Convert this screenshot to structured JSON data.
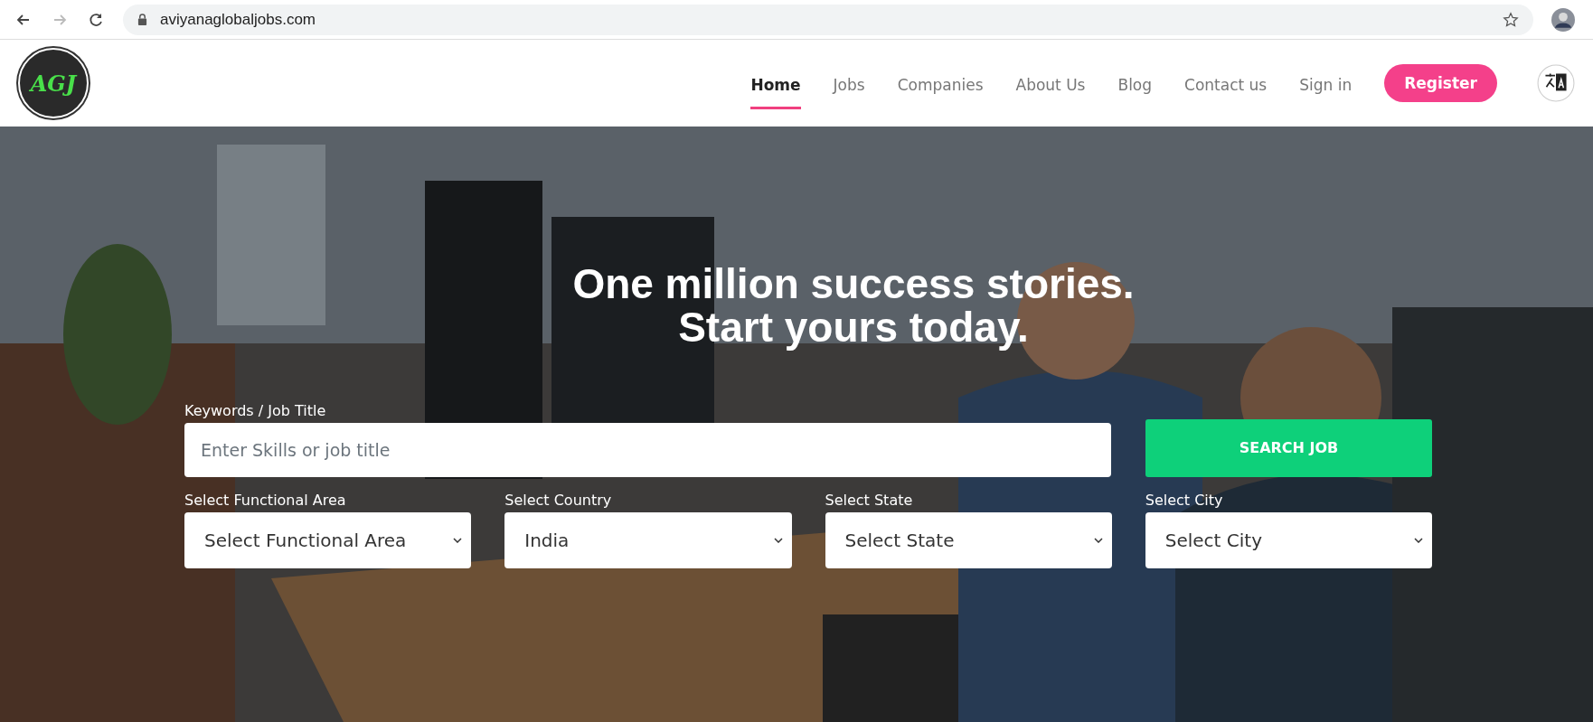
{
  "browser": {
    "url": "aviyanaglobaljobs.com",
    "forward_disabled": true
  },
  "logo": {
    "text": "AGJ"
  },
  "nav": {
    "items": [
      {
        "label": "Home",
        "selected": true
      },
      {
        "label": "Jobs",
        "selected": false
      },
      {
        "label": "Companies",
        "selected": false
      },
      {
        "label": "About Us",
        "selected": false
      },
      {
        "label": "Blog",
        "selected": false
      },
      {
        "label": "Contact us",
        "selected": false
      },
      {
        "label": "Sign in",
        "selected": false
      }
    ],
    "register": "Register"
  },
  "hero": {
    "headline": [
      "One million success stories.",
      "Start yours today."
    ],
    "keywords": {
      "label": "Keywords / Job Title",
      "placeholder": "Enter Skills or job title"
    },
    "search_button": "SEARCH JOB",
    "filters": [
      {
        "label": "Select Functional Area",
        "value": "Select Functional Area"
      },
      {
        "label": "Select Country",
        "value": "India"
      },
      {
        "label": "Select State",
        "value": "Select State"
      },
      {
        "label": "Select City",
        "value": "Select City"
      }
    ]
  }
}
